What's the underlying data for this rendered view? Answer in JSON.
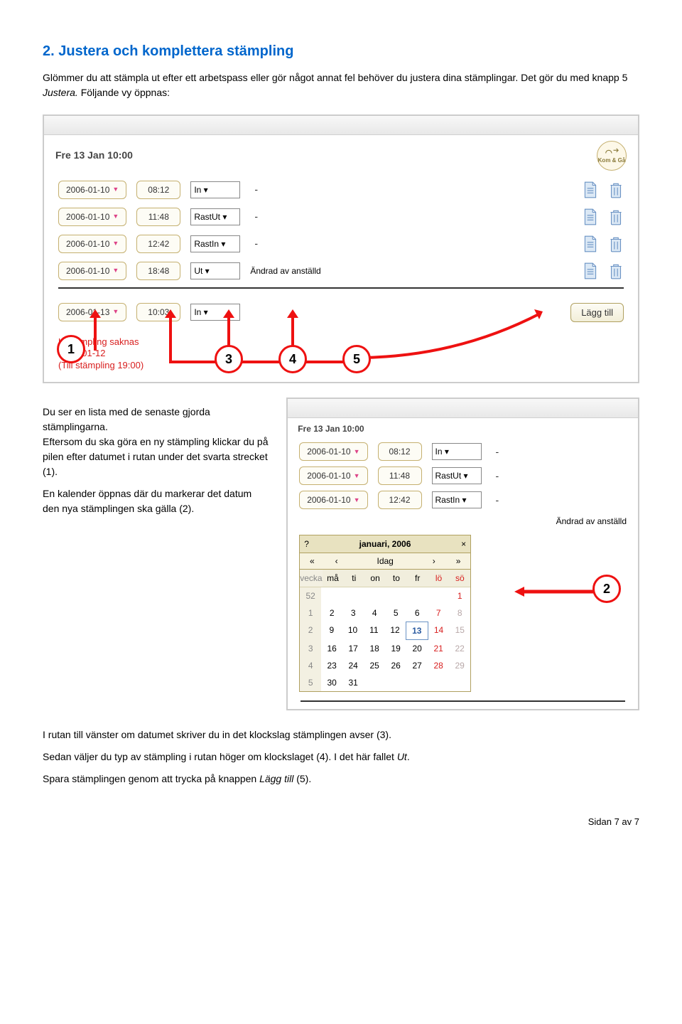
{
  "heading": "2. Justera och komplettera stämpling",
  "intro1": "Glömmer du att stämpla ut efter ett arbetspass eller gör något annat fel behöver du justera dina stämplingar. Det gör du med knapp 5 ",
  "intro1_italic": "Justera.",
  "intro1_tail": " Följande vy öppnas:",
  "shot1": {
    "datetime": "Fre 13 Jan 10:00",
    "kg": "Kom & Gå",
    "rows": [
      {
        "date": "2006-01-10",
        "time": "08:12",
        "type": "In",
        "status": "-"
      },
      {
        "date": "2006-01-10",
        "time": "11:48",
        "type": "RastUt",
        "status": "-"
      },
      {
        "date": "2006-01-10",
        "time": "12:42",
        "type": "RastIn",
        "status": "-"
      },
      {
        "date": "2006-01-10",
        "time": "18:48",
        "type": "Ut",
        "status": "Ändrad av anställd"
      }
    ],
    "newrow": {
      "date": "2006-01-13",
      "time": "10:03",
      "type": "In"
    },
    "add_btn": "Lägg till",
    "warn1": "Utstämpling saknas",
    "warn2": "2006-01-12",
    "warn3": "(Till stämpling 19:00)"
  },
  "circles": {
    "c1": "1",
    "c3": "3",
    "c4": "4",
    "c5": "5",
    "c2": "2"
  },
  "para1": "Du ser en lista med de senaste gjorda stämplingarna.",
  "para2": "Eftersom du ska göra en ny stämpling klickar du på pilen efter datumet i rutan under det svarta strecket (1).",
  "para3": "En kalender öppnas där du markerar det datum den nya stämplingen ska gälla (2).",
  "shot2": {
    "datetime": "Fre 13 Jan 10:00",
    "rows": [
      {
        "date": "2006-01-10",
        "time": "08:12",
        "type": "In",
        "status": "-"
      },
      {
        "date": "2006-01-10",
        "time": "11:48",
        "type": "RastUt",
        "status": "-"
      },
      {
        "date": "2006-01-10",
        "time": "12:42",
        "type": "RastIn",
        "status": "-"
      }
    ],
    "changed": "Ändrad av anställd",
    "cal": {
      "q": "?",
      "title": "januari, 2006",
      "x": "×",
      "prev2": "«",
      "prev": "‹",
      "today": "Idag",
      "next": "›",
      "next2": "»",
      "days": [
        "vecka",
        "må",
        "ti",
        "on",
        "to",
        "fr",
        "lö",
        "sö"
      ],
      "weeks": [
        {
          "w": "52",
          "d": [
            "",
            "",
            "",
            "",
            "",
            "",
            "1"
          ]
        },
        {
          "w": "1",
          "d": [
            "2",
            "3",
            "4",
            "5",
            "6",
            "7",
            "8"
          ]
        },
        {
          "w": "2",
          "d": [
            "9",
            "10",
            "11",
            "12",
            "13",
            "14",
            "15"
          ]
        },
        {
          "w": "3",
          "d": [
            "16",
            "17",
            "18",
            "19",
            "20",
            "21",
            "22"
          ]
        },
        {
          "w": "4",
          "d": [
            "23",
            "24",
            "25",
            "26",
            "27",
            "28",
            "29"
          ]
        },
        {
          "w": "5",
          "d": [
            "30",
            "31",
            "",
            "",
            "",
            "",
            ""
          ]
        }
      ]
    }
  },
  "out1": "I rutan till vänster om datumet skriver du in det klockslag stämplingen avser (3).",
  "out2a": "Sedan väljer du typ av stämpling i rutan höger om klockslaget (4). I det här fallet ",
  "out2b": "Ut",
  "out2c": ".",
  "out3a": "Spara stämplingen genom att trycka på knappen ",
  "out3b": "Lägg till",
  "out3c": " (5).",
  "footer": "Sidan 7 av 7"
}
